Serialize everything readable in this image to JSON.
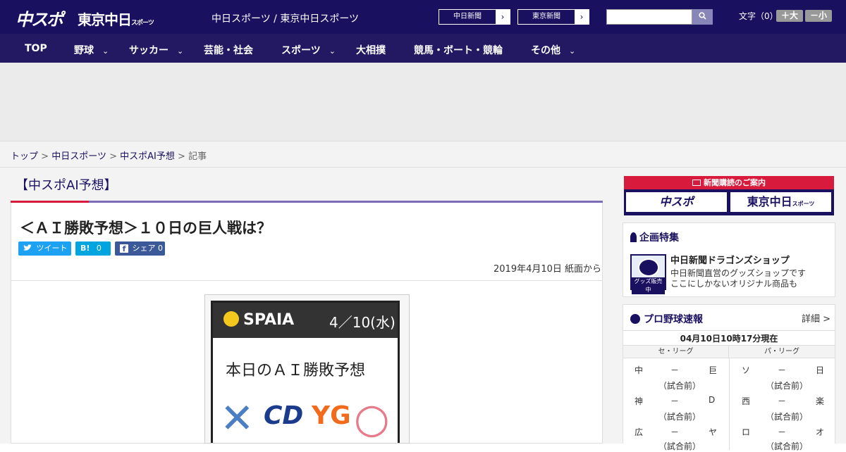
{
  "header": {
    "logo_chuspo": "中スポ",
    "logo_tokyo": "東京中日",
    "logo_tokyo_small": "スポーツ",
    "site_links": "中日スポーツ / 東京中日スポーツ",
    "paper_buttons": [
      {
        "label": "中日新聞",
        "arrow": "›"
      },
      {
        "label": "東京新聞",
        "arrow": "›"
      }
    ],
    "search_placeholder": "",
    "search_icon": "search-icon",
    "font_size_label": "文字（0）",
    "font_bigger": "＋大",
    "font_smaller": "－小"
  },
  "nav": {
    "items": [
      {
        "label": "TOP",
        "chevron": ""
      },
      {
        "label": "野球",
        "chevron": "⌄"
      },
      {
        "label": "サッカー",
        "chevron": "⌄"
      },
      {
        "label": "芸能・社会",
        "chevron": ""
      },
      {
        "label": "スポーツ",
        "chevron": "⌄"
      },
      {
        "label": "大相撲",
        "chevron": ""
      },
      {
        "label": "競馬・ボート・競輪",
        "chevron": ""
      },
      {
        "label": "その他",
        "chevron": "⌄"
      }
    ]
  },
  "breadcrumb": {
    "items": [
      "トップ",
      "中日スポーツ",
      "中スポAI予想"
    ],
    "separator": ">",
    "current": "記事"
  },
  "article": {
    "section": "【中スポAI予想】",
    "title": "＜ＡＩ勝敗予想＞１０日の巨人戦は？",
    "share": {
      "tweet": "ツイート",
      "hatena_count": "0",
      "hatena_icon": "B!",
      "facebook": "シェア 0",
      "facebook_icon": "f"
    },
    "date": "2019年4月10日 紙面から",
    "image": {
      "brand": "SPAIA",
      "date": "4／10(水)",
      "title": "本日のＡＩ勝敗予想",
      "left_mark": "✕",
      "left_team_logo": "CD",
      "right_team_logo": "YG",
      "right_mark": "○"
    }
  },
  "sidebar": {
    "subscribe_header": "新聞購読のご案内",
    "subscribe_papers": [
      "中スポ",
      "東京中日"
    ],
    "subscribe_small": "スポーツ",
    "feature": {
      "heading": "企画特集",
      "shop_title": "中日新聞ドラゴンズショップ",
      "shop_desc1": "中日新聞直営のグッズショップです",
      "shop_desc2": "ここにしかないオリジナル商品も",
      "shop_badge": "グッズ販売中"
    },
    "scores": {
      "heading": "プロ野球速報",
      "detail": "詳細 >",
      "updated": "04月10日10時17分現在",
      "leagues": [
        "セ・リーグ",
        "パ・リーグ"
      ],
      "games": [
        [
          {
            "home": "中",
            "sep": "－",
            "away": "巨",
            "status": "（試合前）"
          },
          {
            "home": "ソ",
            "sep": "－",
            "away": "日",
            "status": "（試合前）"
          }
        ],
        [
          {
            "home": "神",
            "sep": "－",
            "away": "D",
            "status": "（試合前）"
          },
          {
            "home": "西",
            "sep": "－",
            "away": "楽",
            "status": "（試合前）"
          }
        ],
        [
          {
            "home": "広",
            "sep": "－",
            "away": "ヤ",
            "status": "（試合前）"
          },
          {
            "home": "ロ",
            "sep": "－",
            "away": "オ",
            "status": "（試合前）"
          }
        ]
      ]
    }
  }
}
